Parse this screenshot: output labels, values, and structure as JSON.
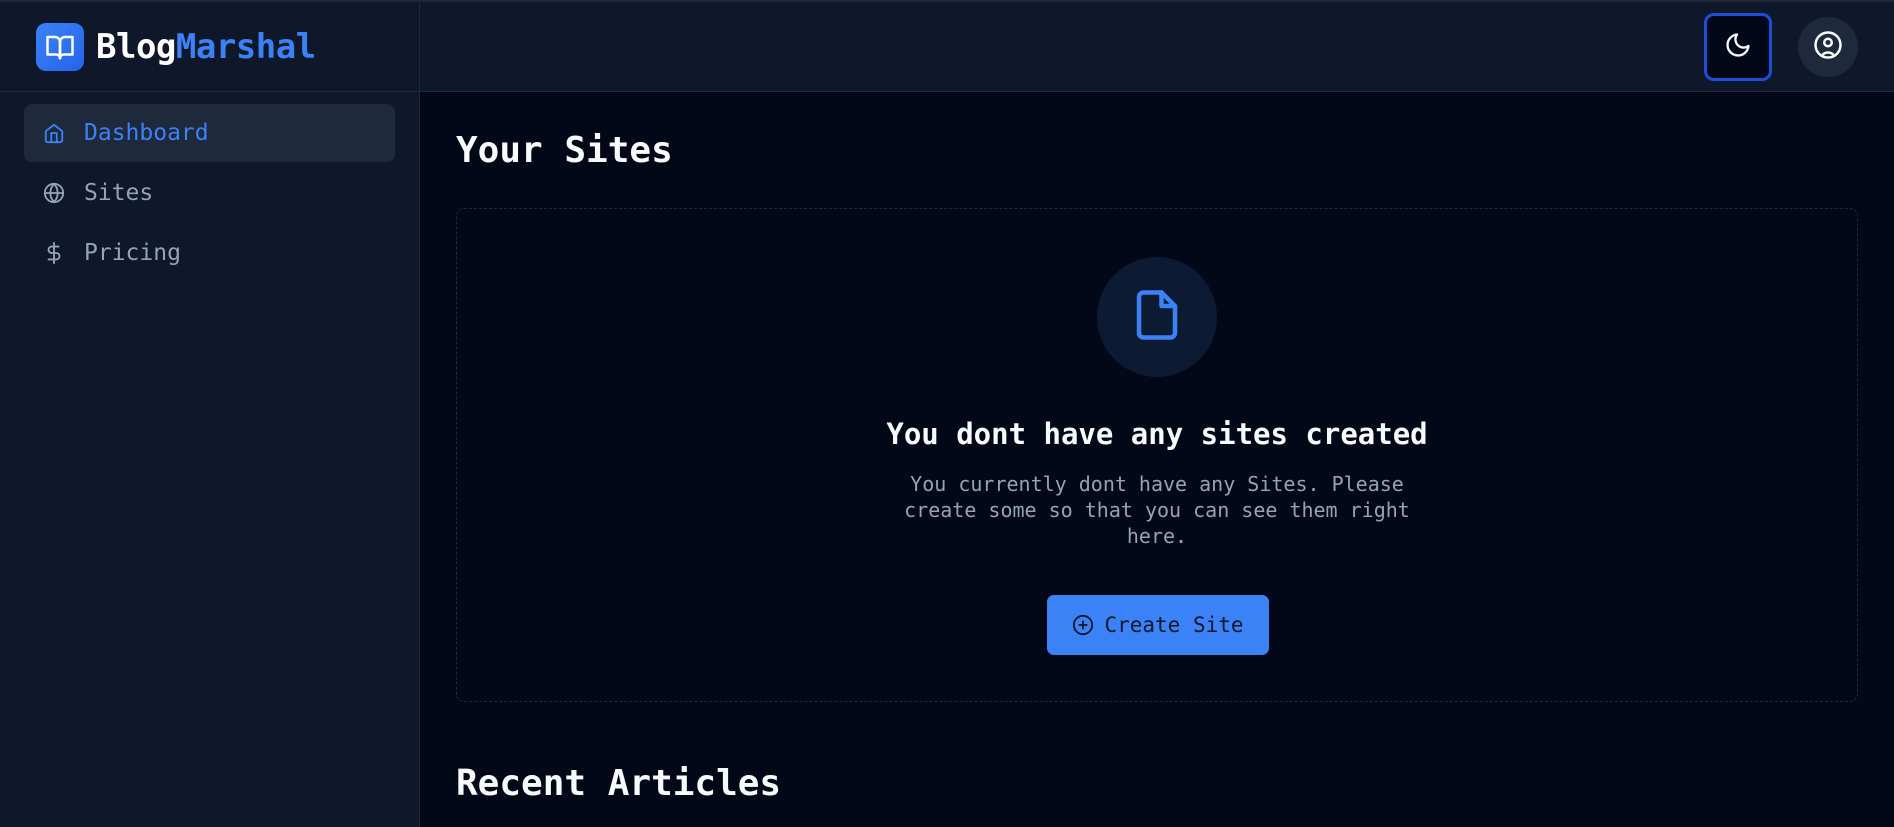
{
  "brand": {
    "name_part1": "Blog",
    "name_part2": "Marshal",
    "logo_icon": "book-open-icon"
  },
  "sidebar": {
    "items": [
      {
        "label": "Dashboard",
        "icon": "home-icon",
        "active": true
      },
      {
        "label": "Sites",
        "icon": "globe-icon",
        "active": false
      },
      {
        "label": "Pricing",
        "icon": "dollar-icon",
        "active": false
      }
    ]
  },
  "header": {
    "theme_icon": "moon-icon",
    "user_icon": "user-circle-icon"
  },
  "main": {
    "sites_title": "Your Sites",
    "empty_state": {
      "icon": "file-icon",
      "title": "You dont have any sites created",
      "description": "You currently dont have any Sites. Please create some so that you can see them right here.",
      "button_label": "Create Site",
      "button_icon": "plus-circle-icon"
    },
    "articles_title": "Recent Articles"
  },
  "colors": {
    "accent": "#3b82f6",
    "background": "#020817",
    "sidebar_bg": "#0f172a",
    "active_item_bg": "#1e293b",
    "muted_text": "#94a3b8"
  }
}
